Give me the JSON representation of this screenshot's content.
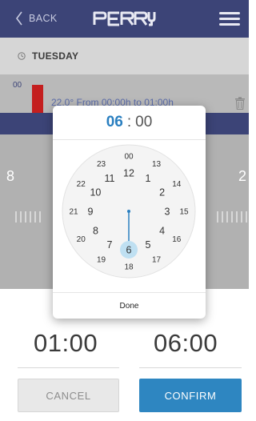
{
  "header": {
    "back_label": "BACK",
    "logo_text": "PERRY"
  },
  "day_bar": {
    "day": "TUESDAY"
  },
  "program": {
    "hour_label": "00",
    "detail": "22.0° From 00:00h to 01:00h"
  },
  "background": {
    "left_number": "8",
    "right_number": "2"
  },
  "time_picker": {
    "selected_hour": "06",
    "separator": ":",
    "selected_minute": "00",
    "outer_hours": [
      "00",
      "13",
      "14",
      "15",
      "16",
      "17",
      "18",
      "19",
      "20",
      "21",
      "22",
      "23"
    ],
    "inner_hours": [
      "12",
      "1",
      "2",
      "3",
      "4",
      "5",
      "6",
      "7",
      "8",
      "9",
      "10",
      "11"
    ],
    "selected_value": "6",
    "done_label": "Done"
  },
  "times": {
    "start": "01:00",
    "end": "06:00"
  },
  "actions": {
    "cancel_label": "CANCEL",
    "confirm_label": "CONFIRM"
  },
  "colors": {
    "header_bg": "#3c4477",
    "accent_blue": "#2a7fc0",
    "confirm_bg": "#2e86c1",
    "program_bar": "#c41f1f",
    "overlay_gray": "#b1b1b1"
  },
  "icons": [
    "chevron-left-icon",
    "hamburger-menu-icon",
    "clock-icon",
    "trash-icon"
  ]
}
